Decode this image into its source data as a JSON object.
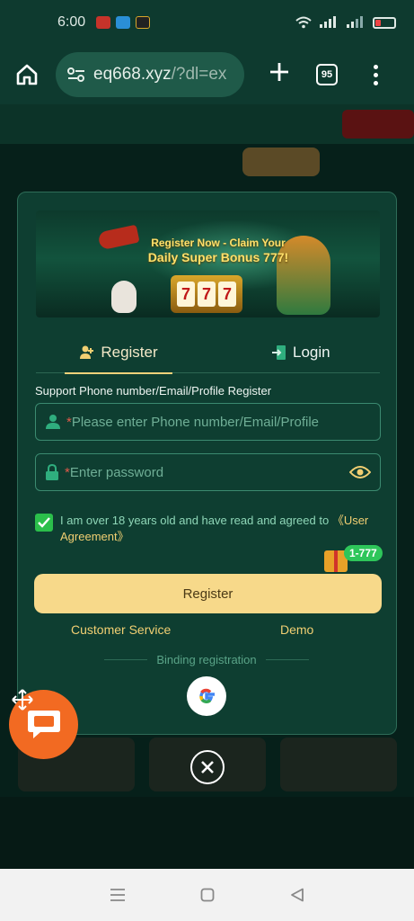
{
  "status_bar": {
    "time": "6:00"
  },
  "browser": {
    "url_host": "eq668.xyz",
    "url_path": "/?dl=ex",
    "tab_count": "95"
  },
  "banner": {
    "headline_line1": "Register Now - Claim Your",
    "headline_line2": "Daily Super Bonus 777!",
    "slot_digits": [
      "7",
      "7",
      "7"
    ]
  },
  "tabs": {
    "register": "Register",
    "login": "Login"
  },
  "form": {
    "label": "Support Phone number/Email/Profile Register",
    "phone_placeholder": "Please enter Phone number/Email/Profile",
    "password_placeholder": "Enter password",
    "required_mark": "*",
    "agreement_text": "I am over 18 years old and have read and agreed to ",
    "agreement_link": "《User Agreement》",
    "agreement_checked": true
  },
  "gift_badge": "1-777",
  "register_button": "Register",
  "links": {
    "customer_service": "Customer Service",
    "demo": "Demo"
  },
  "binding_label": "Binding registration",
  "colors": {
    "accent_gold": "#f7d98a",
    "modal_bg": "#0e3e31",
    "checkbox_green": "#2bbf4b",
    "chat_orange": "#f26a22"
  }
}
